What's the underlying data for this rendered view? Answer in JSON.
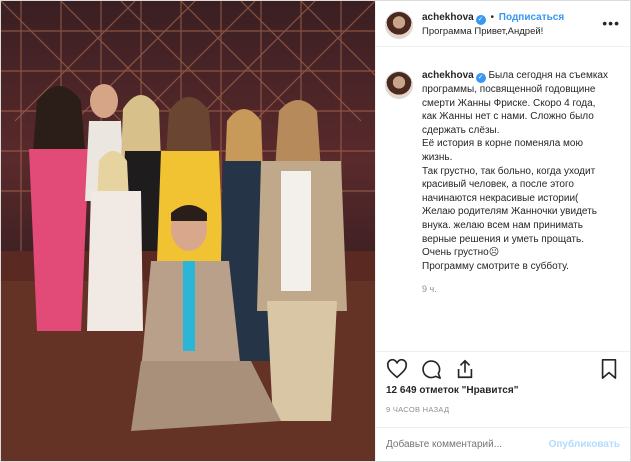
{
  "header": {
    "username": "achekhova",
    "separator": "•",
    "follow_label": "Подписаться",
    "location": "Программа Привет,Андрей!",
    "more_icon": "more-icon"
  },
  "caption": {
    "username": "achekhova",
    "text": "Была сегодня на съемках программы, посвященной годовщине смерти Жанны Фриске. Скоро 4 года, как Жанны нет с нами. Сложно было сдержать слёзы.\nЕё история в корне поменяла мою жизнь.\nТак грустно, так больно, когда уходит красивый человек, а после этого начинаются некрасивые истории(\nЖелаю родителям Жанночки увидеть внука. желаю всем нам принимать верные решения и уметь прощать.\nОчень грустно☹\nПрограмму смотрите в субботу.",
    "time": "9 ч."
  },
  "actions": {
    "icons": [
      "heart-icon",
      "comment-icon",
      "share-icon",
      "bookmark-icon"
    ]
  },
  "likes": {
    "text": "12 649 отметок \"Нравится\""
  },
  "posted_ago": "9 ЧАСОВ НАЗАД",
  "comment_box": {
    "placeholder": "Добавьте комментарий...",
    "publish_label": "Опубликовать"
  },
  "colors": {
    "accent": "#3897f0",
    "muted": "#8e8e8e",
    "publish_disabled": "#b3dbff"
  }
}
